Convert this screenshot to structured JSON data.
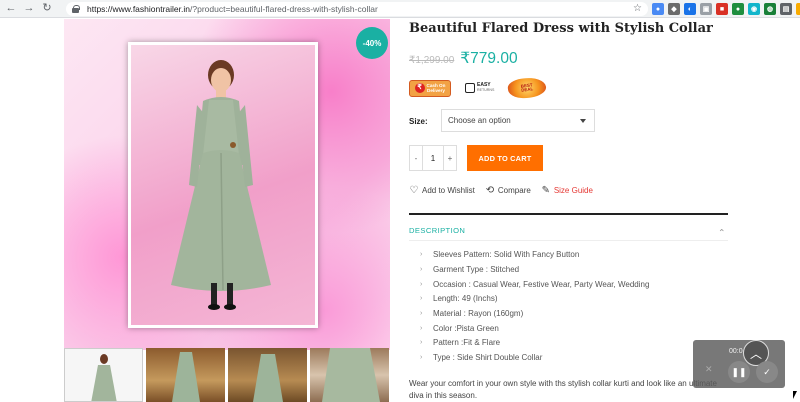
{
  "browser": {
    "url_host": "https://www.fashiontrailer.in",
    "url_rest": "/?product=beautiful-flared-dress-with-stylish-collar"
  },
  "product": {
    "title": "Beautiful Flared Dress with Stylish Collar",
    "price_old": "₹1,299.00",
    "price_new": "₹779.00",
    "discount_badge": "-40%"
  },
  "badges": {
    "cod_line1": "Cash On",
    "cod_line2": "Delivery",
    "easy_title": "EASY",
    "easy_sub": "RETURNS",
    "deal_line1": "BEST",
    "deal_line2": "DEAL"
  },
  "options": {
    "size_label": "Size:",
    "size_select": "Choose an option"
  },
  "cart": {
    "qty_minus": "-",
    "qty_value": "1",
    "qty_plus": "+",
    "add_to_cart": "ADD TO CART"
  },
  "actions": {
    "wishlist": "Add to Wishlist",
    "compare": "Compare",
    "size_guide": "Size Guide"
  },
  "description": {
    "heading": "DESCRIPTION",
    "specs": [
      "Sleeves Pattern: Solid With Fancy Button",
      "Garment Type : Stitched",
      "Occasion : Casual Wear, Festive Wear, Party Wear, Wedding",
      "Length: 49 (Inchs)",
      "Material : Rayon (160gm)",
      "Color :Pista Green",
      "Pattern :Fit & Flare",
      "Type : Side Shirt Double Collar"
    ],
    "text": "Wear your comfort in your own style with ths stylish collar kurti and look like an ultimate diva in this season."
  },
  "recorder": {
    "time": "00:0"
  },
  "colors": {
    "accent": "#1ab0a3",
    "cart_button": "#ff6f00",
    "size_guide": "#e53935"
  }
}
